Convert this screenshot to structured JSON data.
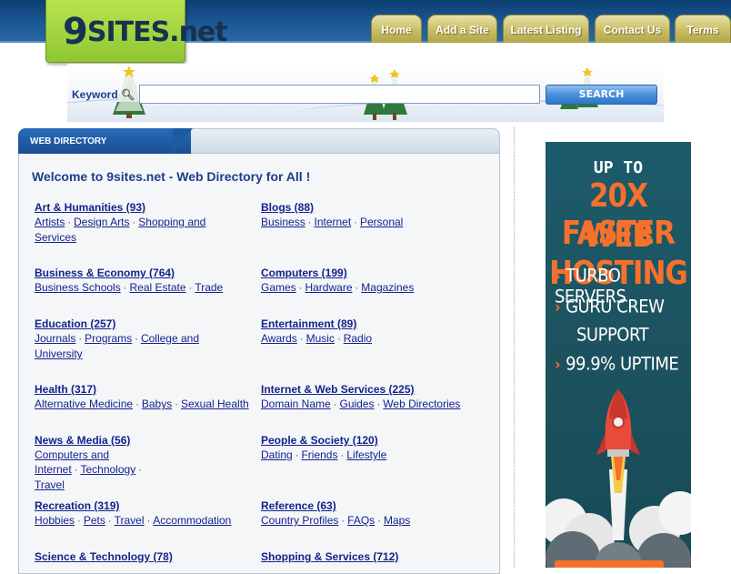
{
  "site": {
    "logo_text": "9SITES.net",
    "accent_colors": {
      "header_blue": "#1d5a98",
      "logo_green": "#a6d43e",
      "tab_gold": "#c8bd63",
      "link_blue": "#15228c",
      "ad_orange": "#f5712c",
      "ad_teal": "#1d5360"
    }
  },
  "nav": {
    "items": [
      {
        "label": "Home"
      },
      {
        "label": "Add a Site"
      },
      {
        "label": "Latest Listing"
      },
      {
        "label": "Contact Us"
      },
      {
        "label": "Terms"
      }
    ]
  },
  "search": {
    "label": "Keyword",
    "input_value": "",
    "button_label": "SEARCH"
  },
  "directory": {
    "header": "WEB DIRECTORY",
    "welcome": "Welcome to 9sites.net - Web Directory for All !",
    "categories": [
      {
        "title": "Art & Humanities (93)",
        "subs": [
          "Artists",
          "Design Arts",
          "Shopping and Services"
        ]
      },
      {
        "title": "Blogs (88)",
        "subs": [
          "Business",
          "Internet",
          "Personal"
        ]
      },
      {
        "title": "Business & Economy (764)",
        "subs": [
          "Business Schools",
          "Real Estate",
          "Trade"
        ]
      },
      {
        "title": "Computers (199)",
        "subs": [
          "Games",
          "Hardware",
          "Magazines"
        ]
      },
      {
        "title": "Education (257)",
        "subs": [
          "Journals",
          "Programs",
          "College and University"
        ]
      },
      {
        "title": "Entertainment (89)",
        "subs": [
          "Awards",
          "Music",
          "Radio"
        ]
      },
      {
        "title": "Health (317)",
        "subs": [
          "Alternative Medicine",
          "Babys",
          "Sexual Health"
        ]
      },
      {
        "title": "Internet & Web Services (225)",
        "subs": [
          "Domain Name",
          "Guides",
          "Web Directories"
        ]
      },
      {
        "title": "News & Media (56)",
        "subs": [
          "Computers and Internet",
          "Technology",
          "Travel"
        ]
      },
      {
        "title": "People & Society (120)",
        "subs": [
          "Dating",
          "Friends",
          "Lifestyle"
        ]
      },
      {
        "title": "Recreation (319)",
        "subs": [
          "Hobbies",
          "Pets",
          "Travel",
          "Accommodation"
        ]
      },
      {
        "title": "Reference (63)",
        "subs": [
          "Country Profiles",
          "FAQs",
          "Maps"
        ]
      },
      {
        "title": "Science & Technology (78)",
        "subs": []
      },
      {
        "title": "Shopping & Services (712)",
        "subs": []
      }
    ]
  },
  "ad": {
    "line1": "UP TO",
    "line2": "20X FASTER",
    "line3": "WEB HOSTING",
    "features": [
      {
        "text": "TURBO SERVERS"
      },
      {
        "text": "GURU CREW",
        "cont": "SUPPORT"
      },
      {
        "text": "99.9% UPTIME"
      }
    ],
    "icon": "rocket-icon"
  }
}
